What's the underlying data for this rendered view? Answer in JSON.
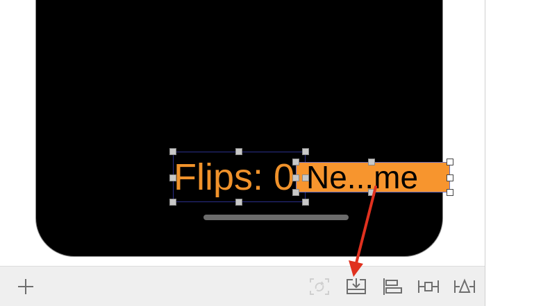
{
  "canvas": {
    "labels": [
      {
        "text": "Flips: 0"
      },
      {
        "text": "Ne...me"
      }
    ]
  },
  "toolbar": {
    "buttons": [
      {
        "name": "add-icon"
      },
      {
        "name": "update-frames-icon"
      },
      {
        "name": "embed-in-icon"
      },
      {
        "name": "align-icon"
      },
      {
        "name": "add-constraints-icon"
      },
      {
        "name": "resolve-issues-icon"
      }
    ]
  },
  "colors": {
    "label_text": "#f0922b",
    "label_fill": "#f7952e",
    "selection_border": "#2a2f8a",
    "annotation_arrow": "#e0311f"
  }
}
